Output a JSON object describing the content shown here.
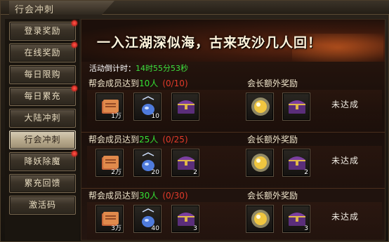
{
  "window": {
    "title": "行会冲刺"
  },
  "sidebar": {
    "items": [
      {
        "label": "登录奖励",
        "badge": true
      },
      {
        "label": "在线奖励",
        "badge": true
      },
      {
        "label": "每日限购",
        "badge": false
      },
      {
        "label": "每日累充",
        "badge": true
      },
      {
        "label": "大陆冲刺",
        "badge": false
      },
      {
        "label": "行会冲刺",
        "badge": false,
        "active": true
      },
      {
        "label": "降妖除魔",
        "badge": true
      },
      {
        "label": "累充回馈",
        "badge": false
      },
      {
        "label": "激活码",
        "badge": false
      }
    ]
  },
  "banner": {
    "slogan": "一入江湖深似海，古来攻沙几人回！"
  },
  "countdown": {
    "label": "活动倒计时：",
    "time": "14时55分53秒"
  },
  "extra_reward_label": "会长额外奖励",
  "tiers": [
    {
      "prefix": "帮会成员达到",
      "target": "10",
      "unit": "人",
      "progress": "(0/10)",
      "rewards": [
        {
          "icon": "scroll-book-icon",
          "count": "1万"
        },
        {
          "icon": "blue-pendant-icon",
          "count": "10"
        },
        {
          "icon": "treasure-chest-icon",
          "count": ""
        }
      ],
      "extra": [
        {
          "icon": "gold-orb-icon",
          "count": ""
        },
        {
          "icon": "treasure-chest-icon",
          "count": ""
        }
      ],
      "status": "未达成"
    },
    {
      "prefix": "帮会成员达到",
      "target": "25",
      "unit": "人",
      "progress": "(0/25)",
      "rewards": [
        {
          "icon": "scroll-book-icon",
          "count": "2万"
        },
        {
          "icon": "blue-pendant-icon",
          "count": "20"
        },
        {
          "icon": "treasure-chest-icon",
          "count": "2"
        }
      ],
      "extra": [
        {
          "icon": "gold-orb-icon",
          "count": ""
        },
        {
          "icon": "treasure-chest-icon",
          "count": "2"
        }
      ],
      "status": "未达成"
    },
    {
      "prefix": "帮会成员达到",
      "target": "30",
      "unit": "人",
      "progress": "(0/30)",
      "rewards": [
        {
          "icon": "scroll-book-icon",
          "count": "3万"
        },
        {
          "icon": "blue-pendant-icon",
          "count": "40"
        },
        {
          "icon": "treasure-chest-icon",
          "count": "3"
        }
      ],
      "extra": [
        {
          "icon": "gold-orb-icon",
          "count": ""
        },
        {
          "icon": "treasure-chest-icon",
          "count": "3"
        }
      ],
      "status": "未达成"
    }
  ]
}
